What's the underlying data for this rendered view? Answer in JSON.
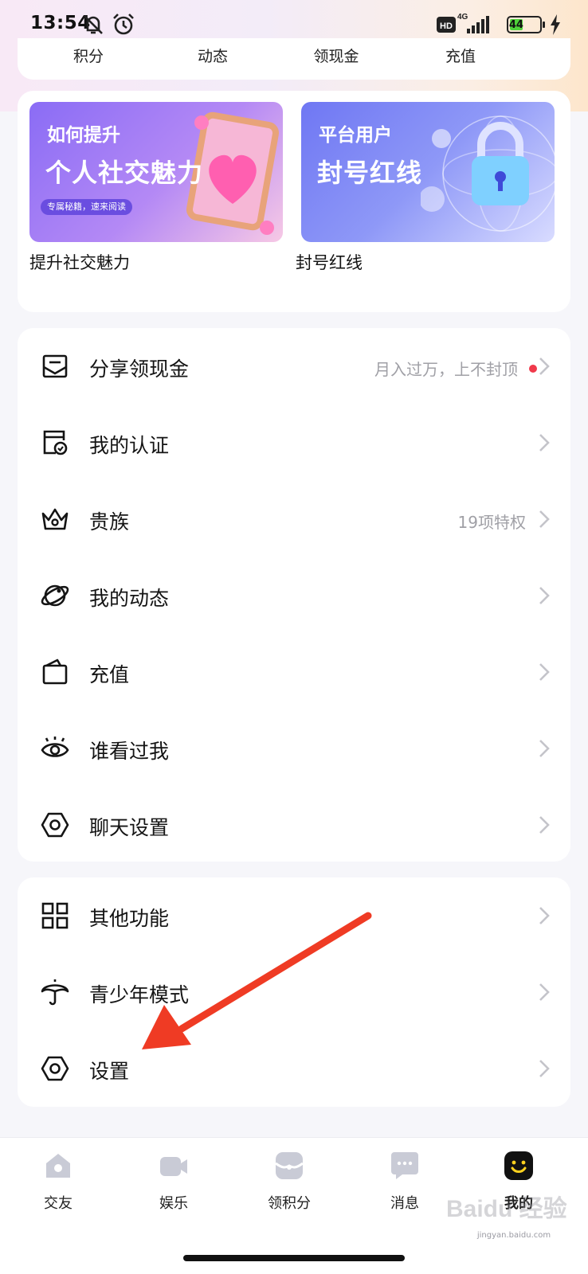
{
  "status_bar": {
    "time": "13:54",
    "network_badge": "HD",
    "network_type": "4G",
    "battery_level": "44",
    "battery_percent": 44
  },
  "stats": [
    "积分",
    "动态",
    "领现金",
    "充值"
  ],
  "banners": [
    {
      "line1": "如何提升",
      "line2": "个人社交魅力",
      "tag": "专属秘籍，速来阅读",
      "caption": "提升社交魅力"
    },
    {
      "line1": "平台用户",
      "line2": "封号红线",
      "caption": "封号红线"
    }
  ],
  "menu_group_1": [
    {
      "label": "分享领现金",
      "right_text": "月入过万，上不封顶",
      "has_dot": true,
      "icon": "share-envelope-icon"
    },
    {
      "label": "我的认证",
      "right_text": "",
      "icon": "certification-icon"
    },
    {
      "label": "贵族",
      "right_text": "19项特权",
      "icon": "crown-icon"
    },
    {
      "label": "我的动态",
      "right_text": "",
      "icon": "planet-icon"
    },
    {
      "label": "充值",
      "right_text": "",
      "icon": "wallet-icon"
    },
    {
      "label": "谁看过我",
      "right_text": "",
      "icon": "eye-icon"
    },
    {
      "label": "聊天设置",
      "right_text": "",
      "icon": "hex-settings-icon"
    }
  ],
  "menu_group_2": [
    {
      "label": "其他功能",
      "icon": "grid-icon"
    },
    {
      "label": "青少年模式",
      "icon": "umbrella-icon"
    },
    {
      "label": "设置",
      "icon": "hex-settings-icon"
    }
  ],
  "bottom_nav": [
    {
      "label": "交友",
      "icon": "home-icon",
      "active": false
    },
    {
      "label": "娱乐",
      "icon": "video-icon",
      "active": false
    },
    {
      "label": "领积分",
      "icon": "points-icon",
      "active": false
    },
    {
      "label": "消息",
      "icon": "message-icon",
      "active": false
    },
    {
      "label": "我的",
      "icon": "smile-profile-icon",
      "active": true
    }
  ],
  "watermark": {
    "brand": "Baidu 经验",
    "url": "jingyan.baidu.com"
  },
  "colors": {
    "accent_red": "#f0394b",
    "arrow_red": "#ef3b24",
    "nav_inactive": "#c9cbd6",
    "nav_active": "#111111"
  }
}
